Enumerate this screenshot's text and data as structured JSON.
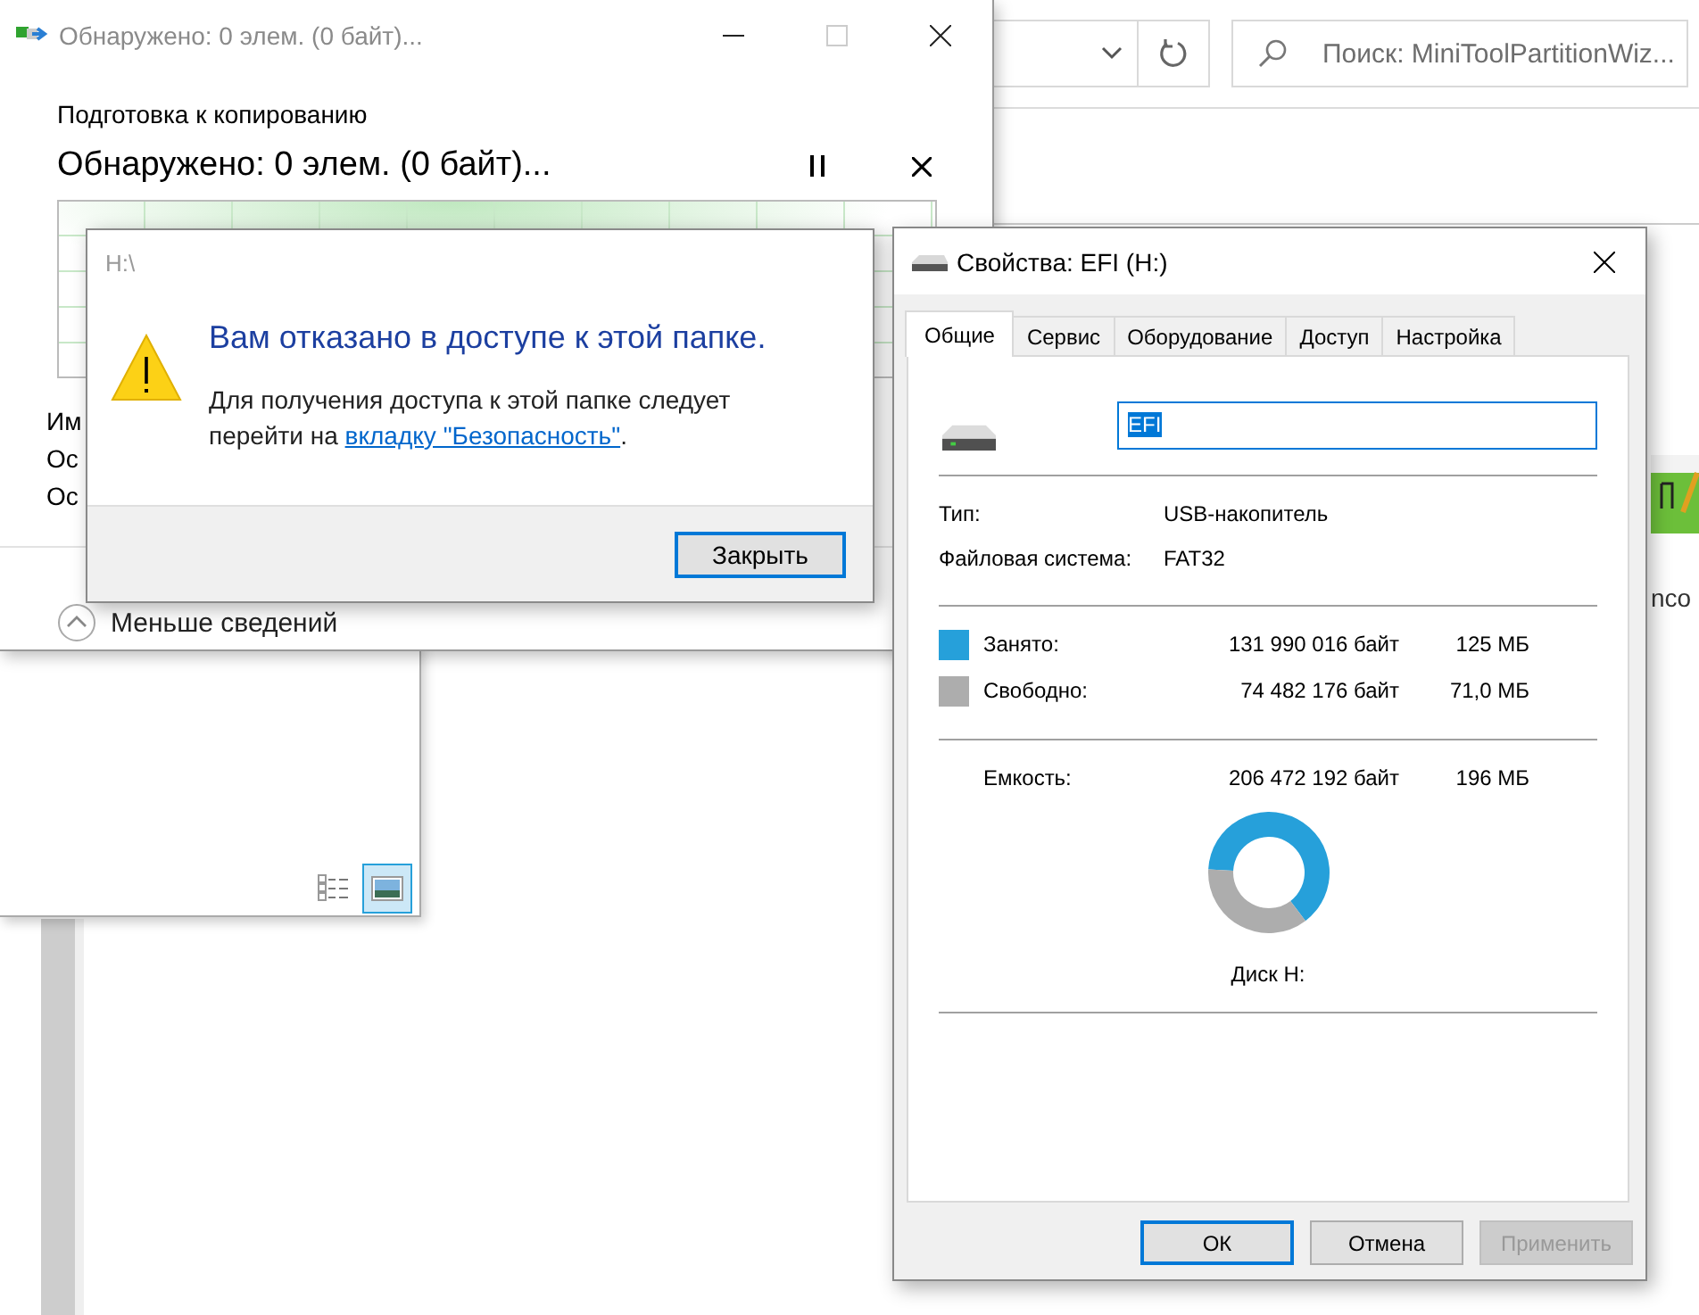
{
  "explorer": {
    "search": {
      "placeholder": "Поиск: MiniToolPartitionWiz..."
    },
    "file": {
      "label": "nco"
    }
  },
  "copy_dialog": {
    "title": "Обнаружено: 0 элем. (0 байт)...",
    "title_buttons": [
      {
        "kind": "minimize",
        "disabled": false
      },
      {
        "kind": "maximize",
        "disabled": true
      },
      {
        "kind": "close",
        "disabled": false
      }
    ],
    "status": "Подготовка к копированию",
    "heading": "Обнаружено: 0 элем. (0 байт)...",
    "details": [
      "Им",
      "Ос",
      "Ос"
    ],
    "toggle": "Меньше сведений"
  },
  "preview_window": {
    "views": [
      {
        "kind": "details",
        "selected": false
      },
      {
        "kind": "preview",
        "selected": true
      }
    ]
  },
  "error_dialog": {
    "title": "H:\\",
    "heading": "Вам отказано в доступе к этой папке.",
    "message": "Для получения доступа к этой папке следует перейти на ",
    "link": "вкладку \"Безопасность\"",
    "message_end": ".",
    "button": {
      "label": "Закрыть",
      "default": true
    }
  },
  "properties": {
    "title": "Свойства: EFI (H:)",
    "tabs": [
      {
        "label": "Общие",
        "selected": true
      },
      {
        "label": "Сервис",
        "selected": false
      },
      {
        "label": "Оборудование",
        "selected": false
      },
      {
        "label": "Доступ",
        "selected": false
      },
      {
        "label": "Настройка",
        "selected": false
      }
    ],
    "name": {
      "value": "EFI",
      "selected": true
    },
    "info": [
      {
        "label": "Тип:",
        "value": "USB-накопитель"
      },
      {
        "label": "Файловая система:",
        "value": "FAT32"
      }
    ],
    "usage": [
      {
        "label": "Занято:",
        "bytes": "131 990 016 байт",
        "size": "125 МБ",
        "color": "#26a0da"
      },
      {
        "label": "Свободно:",
        "bytes": "74 482 176 байт",
        "size": "71,0 МБ",
        "color": "#adadad"
      }
    ],
    "capacity": {
      "label": "Емкость:",
      "bytes": "206 472 192 байт",
      "size": "196 МБ"
    },
    "chart_data": {
      "type": "donut",
      "title": "Диск H:",
      "values": [
        63.9,
        36.1
      ]
    },
    "buttons": [
      {
        "label": "ОК",
        "default": true,
        "disabled": false
      },
      {
        "label": "Отмена",
        "default": false,
        "disabled": false
      },
      {
        "label": "Применить",
        "default": false,
        "disabled": true
      }
    ]
  }
}
